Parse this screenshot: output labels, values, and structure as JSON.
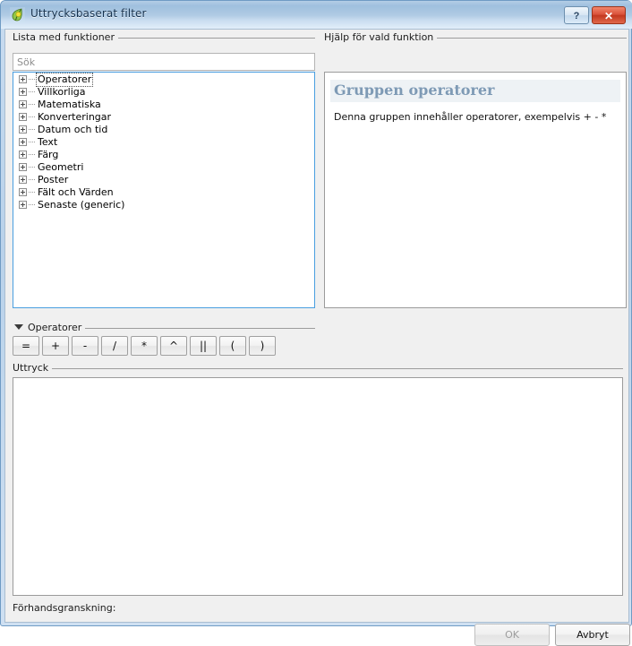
{
  "window": {
    "title": "Uttrycksbaserat filter",
    "app_icon": "qgis-leaf-icon",
    "help_button_label": "?",
    "close_button_label": "✕"
  },
  "function_list": {
    "group_label": "Lista med funktioner",
    "search_placeholder": "Sök",
    "search_value": "",
    "items": [
      {
        "label": "Operatorer",
        "expanded": false,
        "selected": true
      },
      {
        "label": "Villkorliga",
        "expanded": false,
        "selected": false
      },
      {
        "label": "Matematiska",
        "expanded": false,
        "selected": false
      },
      {
        "label": "Konverteringar",
        "expanded": false,
        "selected": false
      },
      {
        "label": "Datum och tid",
        "expanded": false,
        "selected": false
      },
      {
        "label": "Text",
        "expanded": false,
        "selected": false
      },
      {
        "label": "Färg",
        "expanded": false,
        "selected": false
      },
      {
        "label": "Geometri",
        "expanded": false,
        "selected": false
      },
      {
        "label": "Poster",
        "expanded": false,
        "selected": false
      },
      {
        "label": "Fält och Värden",
        "expanded": false,
        "selected": false
      },
      {
        "label": "Senaste (generic)",
        "expanded": false,
        "selected": false
      }
    ]
  },
  "help": {
    "group_label": "Hjälp för vald funktion",
    "heading": "Gruppen operatorer",
    "body": "Denna gruppen innehåller operatorer, exempelvis + - *",
    "heading_color": "#7e9ab5"
  },
  "operators": {
    "section_label": "Operatorer",
    "collapsed": false,
    "buttons": [
      {
        "label": "=",
        "name": "equals"
      },
      {
        "label": "+",
        "name": "plus"
      },
      {
        "label": "-",
        "name": "minus"
      },
      {
        "label": "/",
        "name": "divide"
      },
      {
        "label": "*",
        "name": "multiply"
      },
      {
        "label": "^",
        "name": "power"
      },
      {
        "label": "||",
        "name": "concat"
      },
      {
        "label": "(",
        "name": "open-paren"
      },
      {
        "label": ")",
        "name": "close-paren"
      }
    ]
  },
  "expression": {
    "group_label": "Uttryck",
    "value": ""
  },
  "footer": {
    "preview_label": "Förhandsgranskning:",
    "preview_value": "",
    "ok_label": "OK",
    "ok_enabled": false,
    "cancel_label": "Avbryt",
    "cancel_enabled": true
  }
}
